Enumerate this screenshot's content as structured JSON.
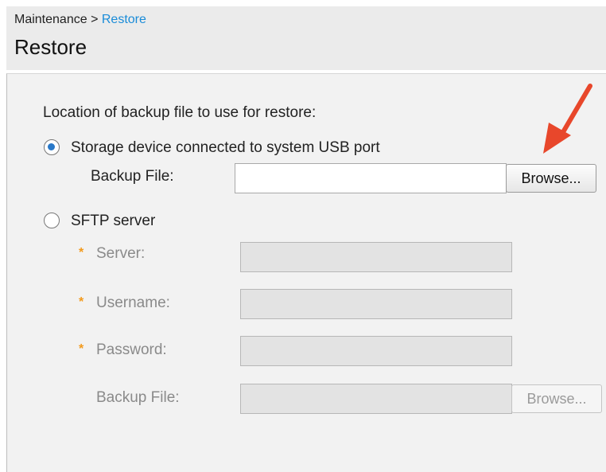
{
  "breadcrumb": {
    "parent": "Maintenance",
    "separator": ">",
    "current": "Restore"
  },
  "page_title": "Restore",
  "prompt": "Location of backup file to use for restore:",
  "usb_option": {
    "label": "Storage device connected to system USB port",
    "selected": true,
    "backup_file_label": "Backup File:",
    "backup_file_value": "",
    "browse_label": "Browse..."
  },
  "sftp_option": {
    "label": "SFTP server",
    "selected": false,
    "required_marker": "*",
    "server_label": "Server:",
    "username_label": "Username:",
    "password_label": "Password:",
    "backup_file_label": "Backup File:",
    "browse_label": "Browse..."
  },
  "annotation": {
    "arrow_color": "#e8472b"
  }
}
